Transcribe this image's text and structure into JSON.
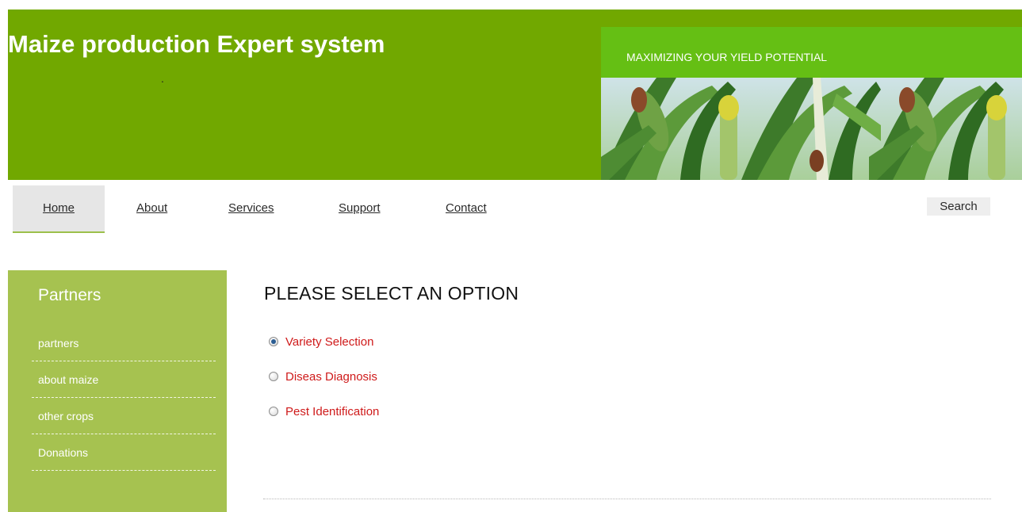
{
  "header": {
    "title": "Maize production Expert system",
    "dot": ".",
    "tagline": "MAXIMIZING YOUR YIELD POTENTIAL",
    "colors": {
      "header_bg": "#71a800",
      "tagline_bg": "#65bf14"
    }
  },
  "nav": {
    "items": [
      {
        "label": "Home",
        "active": true
      },
      {
        "label": "About"
      },
      {
        "label": "Services"
      },
      {
        "label": "Support"
      },
      {
        "label": "Contact"
      }
    ],
    "search_label": "Search"
  },
  "sidebar": {
    "title": "Partners",
    "items": [
      {
        "label": "partners"
      },
      {
        "label": "about maize"
      },
      {
        "label": "other crops"
      },
      {
        "label": "Donations"
      }
    ],
    "color": "#a6c250"
  },
  "main": {
    "heading": "PLEASE SELECT AN OPTION",
    "options": [
      {
        "label": "Variety Selection",
        "checked": true
      },
      {
        "label": "Diseas Diagnosis",
        "checked": false
      },
      {
        "label": "Pest Identification",
        "checked": false
      }
    ],
    "option_color": "#cf1a1a"
  }
}
